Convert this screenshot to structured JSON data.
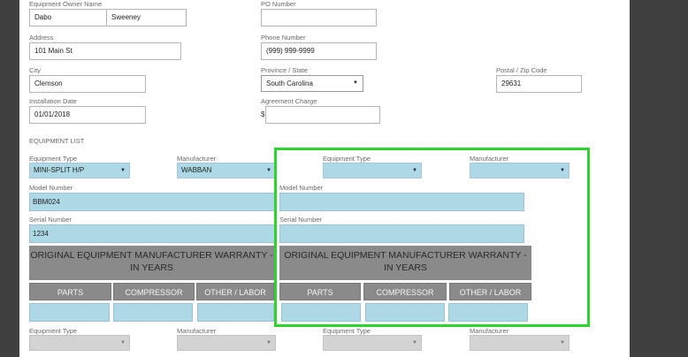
{
  "owner": {
    "label": "Equipment Owner Name",
    "first_name": "Dabo",
    "last_name": "Sweeney",
    "address_label": "Address",
    "address": "101 Main St",
    "city_label": "City",
    "city": "Clemson",
    "install_date_label": "Installation Date",
    "install_date": "01/01/2018"
  },
  "right_fields": {
    "po_label": "PO Number",
    "po_value": "",
    "phone_label": "Phone Number",
    "phone": "(999) 999-9999",
    "province_label": "Province / State",
    "province": "South Carolina",
    "postal_label": "Postal / Zip Code",
    "postal": "29631",
    "agreement_label": "Agreement Charge",
    "currency": "$",
    "agreement_value": ""
  },
  "equipment_list": {
    "title": "EQUIPMENT LIST",
    "caret": "▼",
    "equipment_type_label": "Equipment Type",
    "manufacturer_label": "Manufacturer",
    "model_number_label": "Model Number",
    "serial_number_label": "Serial Number",
    "warranty_title": "ORIGINAL EQUIPMENT MANUFACTURER WARRANTY - IN YEARS",
    "warranty_columns": [
      "PARTS",
      "COMPRESSOR",
      "OTHER / LABOR"
    ],
    "cards": [
      {
        "equipment_type": "MINI-SPLIT H/P",
        "manufacturer": "WABBAN",
        "model_number": "BBM024",
        "serial_number": "1234"
      },
      {
        "equipment_type": "",
        "manufacturer": "",
        "model_number": "",
        "serial_number": ""
      }
    ]
  },
  "colors": {
    "field_fill": "#add8e6",
    "warranty_fill": "#8a8a8a",
    "highlight": "#2ed32e",
    "background": "#3a3a3a"
  }
}
